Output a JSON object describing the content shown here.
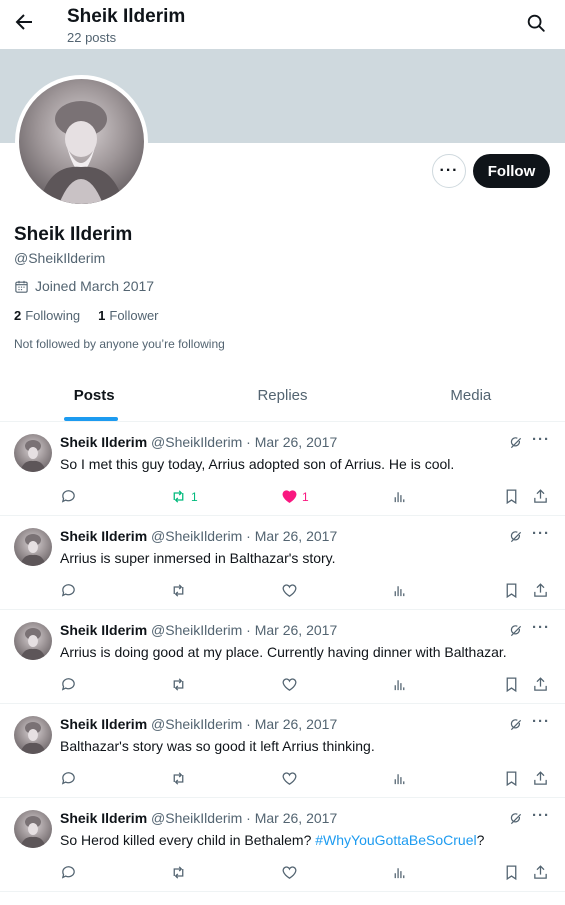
{
  "header": {
    "name": "Sheik Ilderim",
    "posts_count": "22 posts"
  },
  "profile": {
    "name": "Sheik Ilderim",
    "handle": "@SheikIlderim",
    "joined": "Joined March 2017",
    "following_count": "2",
    "following_label": "Following",
    "followers_count": "1",
    "followers_label": "Follower",
    "not_followed": "Not followed by anyone you’re following",
    "more_label": "···",
    "follow_label": "Follow"
  },
  "tabs": [
    {
      "label": "Posts"
    },
    {
      "label": "Replies"
    },
    {
      "label": "Media"
    }
  ],
  "tweets": [
    {
      "name": "Sheik Ilderim",
      "handle_date": "@SheikIlderim · Mar 26, 2017",
      "text": "So I met this guy today, Arrius adopted son of Arrius. He is cool.",
      "hashtag": "",
      "text_after": "",
      "retweets": "1",
      "likes": "1",
      "retweeted": true,
      "liked": true
    },
    {
      "name": "Sheik Ilderim",
      "handle_date": "@SheikIlderim · Mar 26, 2017",
      "text": "Arrius is super inmersed in Balthazar's story.",
      "hashtag": "",
      "text_after": "",
      "retweets": "",
      "likes": "",
      "retweeted": false,
      "liked": false
    },
    {
      "name": "Sheik Ilderim",
      "handle_date": "@SheikIlderim · Mar 26, 2017",
      "text": "Arrius is doing good at my place. Currently having dinner with Balthazar.",
      "hashtag": "",
      "text_after": "",
      "retweets": "",
      "likes": "",
      "retweeted": false,
      "liked": false
    },
    {
      "name": "Sheik Ilderim",
      "handle_date": "@SheikIlderim · Mar 26, 2017",
      "text": "Balthazar's story was so good it left Arrius thinking.",
      "hashtag": "",
      "text_after": "",
      "retweets": "",
      "likes": "",
      "retweeted": false,
      "liked": false
    },
    {
      "name": "Sheik Ilderim",
      "handle_date": "@SheikIlderim · Mar 26, 2017",
      "text": "So Herod killed every child in Bethalem? ",
      "hashtag": "#WhyYouGottaBeSoCruel",
      "text_after": "?",
      "retweets": "",
      "likes": "",
      "retweeted": false,
      "liked": false
    }
  ],
  "colors": {
    "accent": "#1d9bf0",
    "like": "#f91880",
    "retweet": "#00ba7c",
    "text": "#0f1419",
    "muted": "#536471"
  },
  "icons": {
    "back": "arrow-left-icon",
    "search": "search-icon",
    "calendar": "calendar-icon",
    "grok": "grok-icon",
    "reply": "reply-icon",
    "retweet": "retweet-icon",
    "like": "heart-icon",
    "views": "views-icon",
    "bookmark": "bookmark-icon",
    "share": "share-icon"
  }
}
